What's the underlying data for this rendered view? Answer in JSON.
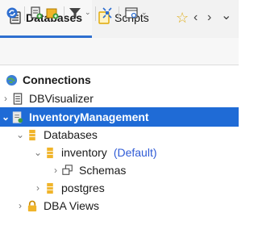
{
  "tabs": [
    {
      "label": "Databases",
      "active": true
    },
    {
      "label": "Scripts",
      "active": false
    }
  ],
  "tab_controls": [
    "☆",
    "‹",
    "›",
    "⌄"
  ],
  "toolbar": {
    "icons": [
      "refresh-icon",
      "new-connection-icon",
      "add-icon",
      "filter-icon",
      "collapse-icon",
      "view-icon"
    ]
  },
  "tree": {
    "connections_label": "Connections",
    "dbvisualizer_label": "DBVisualizer",
    "inventory_mgmt_label": "InventoryManagement",
    "databases_label": "Databases",
    "inventory_label": "inventory",
    "inventory_default": "(Default)",
    "schemas_label": "Schemas",
    "postgres_label": "postgres",
    "dba_views_label": "DBA Views"
  },
  "colors": {
    "accent": "#2f6fd0",
    "selection": "#1f6bd6",
    "db_icon": "#f0b429"
  }
}
